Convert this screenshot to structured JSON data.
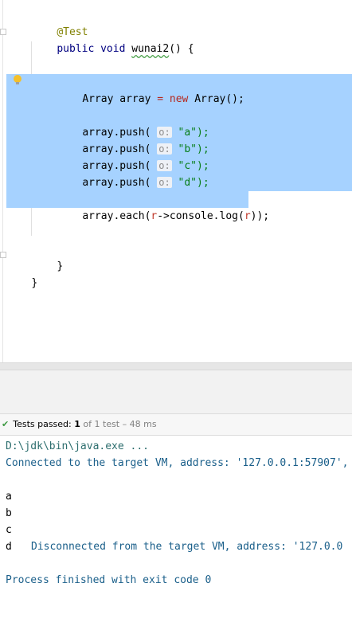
{
  "editor": {
    "lines": {
      "annotation": "@Test",
      "kw_public": "public",
      "kw_void": "void",
      "method_name": "wunai2",
      "method_sig_rest": "() {",
      "array_type": "Array",
      "array_var": "array",
      "assign": "=",
      "kw_new": "new",
      "ctor": "Array();",
      "push_prefix": "array.push(",
      "hint_o": "o:",
      "push_a": "\"a\");",
      "push_b": "\"b\");",
      "push_c": "\"c\");",
      "push_d": "\"d\");",
      "each_prefix": "array.each(",
      "lambda_param": "r",
      "each_mid": "->console.log(",
      "lambda_param2": "r",
      "each_suffix": "));",
      "close_method": "}",
      "close_class": "}"
    }
  },
  "test_status": {
    "label": "Tests passed:",
    "passed": "1",
    "of_text": "of 1 test",
    "duration": "– 48 ms"
  },
  "console": {
    "command": "D:\\jdk\\bin\\java.exe ...",
    "connected": "Connected to the target VM, address: '127.0.0.1:57907',",
    "out_a": "a",
    "out_b": "b",
    "out_c": "c",
    "out_d": "d",
    "disconnected": "Disconnected from the target VM, address: '127.0.0",
    "finished": "Process finished with exit code 0"
  },
  "colors": {
    "selection": "#a6d2ff",
    "keyword": "#000080",
    "string": "#067d17",
    "pass_green": "#3f9a44"
  }
}
